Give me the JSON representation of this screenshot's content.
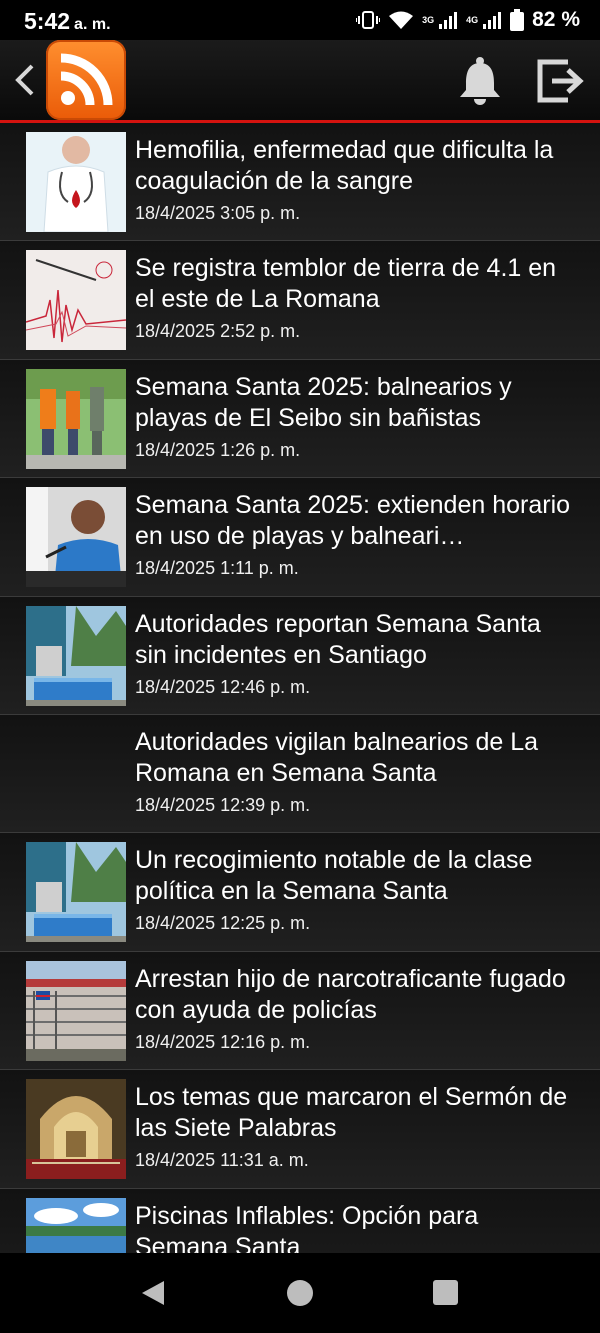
{
  "status_bar": {
    "time": "5:42",
    "ampm": "a. m.",
    "net_3g": "3G",
    "net_4g": "4G",
    "battery": "82 %"
  },
  "app_bar": {
    "logo_icon": "rss-icon",
    "accent_color": "#d4130f",
    "logo_color": "#f47216"
  },
  "feed": {
    "items": [
      {
        "title": "Hemofilia, enfermedad que dificulta la coagulación de la sangre",
        "date": "18/4/2025 3:05 p. m."
      },
      {
        "title": "Se registra temblor de tierra de 4.1 en el este de La Romana",
        "date": "18/4/2025 2:52 p. m."
      },
      {
        "title": "Semana Santa 2025: balnearios y playas de El Seibo sin bañistas",
        "date": "18/4/2025 1:26 p. m."
      },
      {
        "title": "Semana Santa 2025: extienden horario en uso de playas y balneari…",
        "date": "18/4/2025 1:11 p. m."
      },
      {
        "title": "Autoridades reportan Semana Santa sin incidentes en Santiago",
        "date": "18/4/2025 12:46 p. m."
      },
      {
        "title": "Autoridades vigilan balnearios de La Romana en Semana Santa",
        "date": "18/4/2025 12:39 p. m."
      },
      {
        "title": "Un recogimiento notable de la clase política en la Semana Santa",
        "date": "18/4/2025 12:25 p. m."
      },
      {
        "title": "Arrestan hijo de narcotraficante fugado con ayuda de policías",
        "date": "18/4/2025 12:16 p. m."
      },
      {
        "title": "Los temas que marcaron el Sermón de las Siete Palabras",
        "date": "18/4/2025 11:31 a. m."
      },
      {
        "title": "Piscinas Inflables: Opción para Semana Santa",
        "date": ""
      }
    ]
  }
}
